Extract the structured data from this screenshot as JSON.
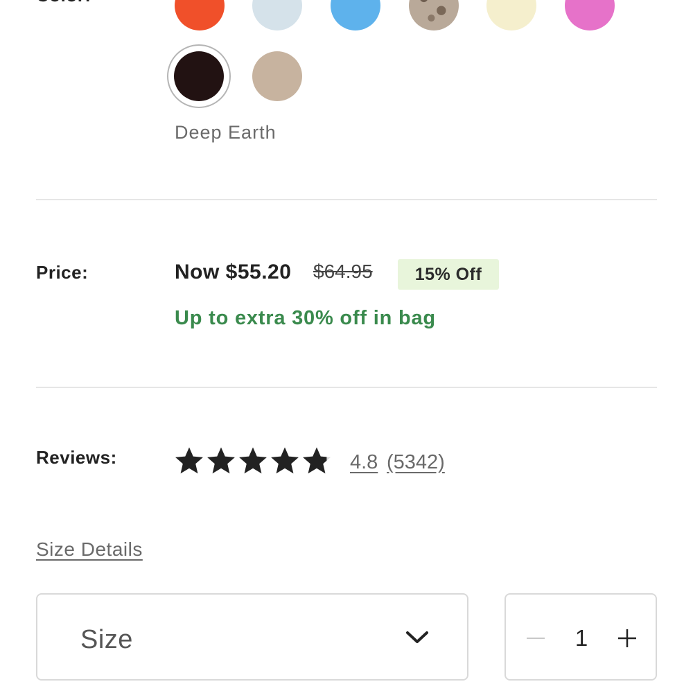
{
  "color": {
    "label": "Color:",
    "selected_name": "Deep Earth",
    "swatches": [
      {
        "name": "orange",
        "color": "#f0502a"
      },
      {
        "name": "light-blue",
        "color": "#d5e2ea"
      },
      {
        "name": "sky-blue",
        "color": "#5eb2ec"
      },
      {
        "name": "leopard",
        "color": "#b9a999"
      },
      {
        "name": "cream",
        "color": "#f5efcd"
      },
      {
        "name": "pink",
        "color": "#e672c9"
      },
      {
        "name": "deep-earth",
        "color": "#221212",
        "selected": true
      },
      {
        "name": "taupe",
        "color": "#c7b39f"
      }
    ]
  },
  "price": {
    "label": "Price:",
    "now": "Now $55.20",
    "was": "$64.95",
    "badge": "15% Off",
    "promo": "Up to extra 30% off in bag",
    "promo_color": "#3a8a4d",
    "badge_color": "#e8f5db"
  },
  "reviews": {
    "label": "Reviews:",
    "rating": "4.8",
    "count": "(5342)",
    "stars_value": 4.8,
    "stars_max": 5
  },
  "size": {
    "details_link": "Size Details",
    "select_placeholder": "Size",
    "chevron_icon": "chevron-down-icon"
  },
  "quantity": {
    "value": "1",
    "minus_icon": "minus-icon",
    "plus_icon": "plus-icon"
  }
}
